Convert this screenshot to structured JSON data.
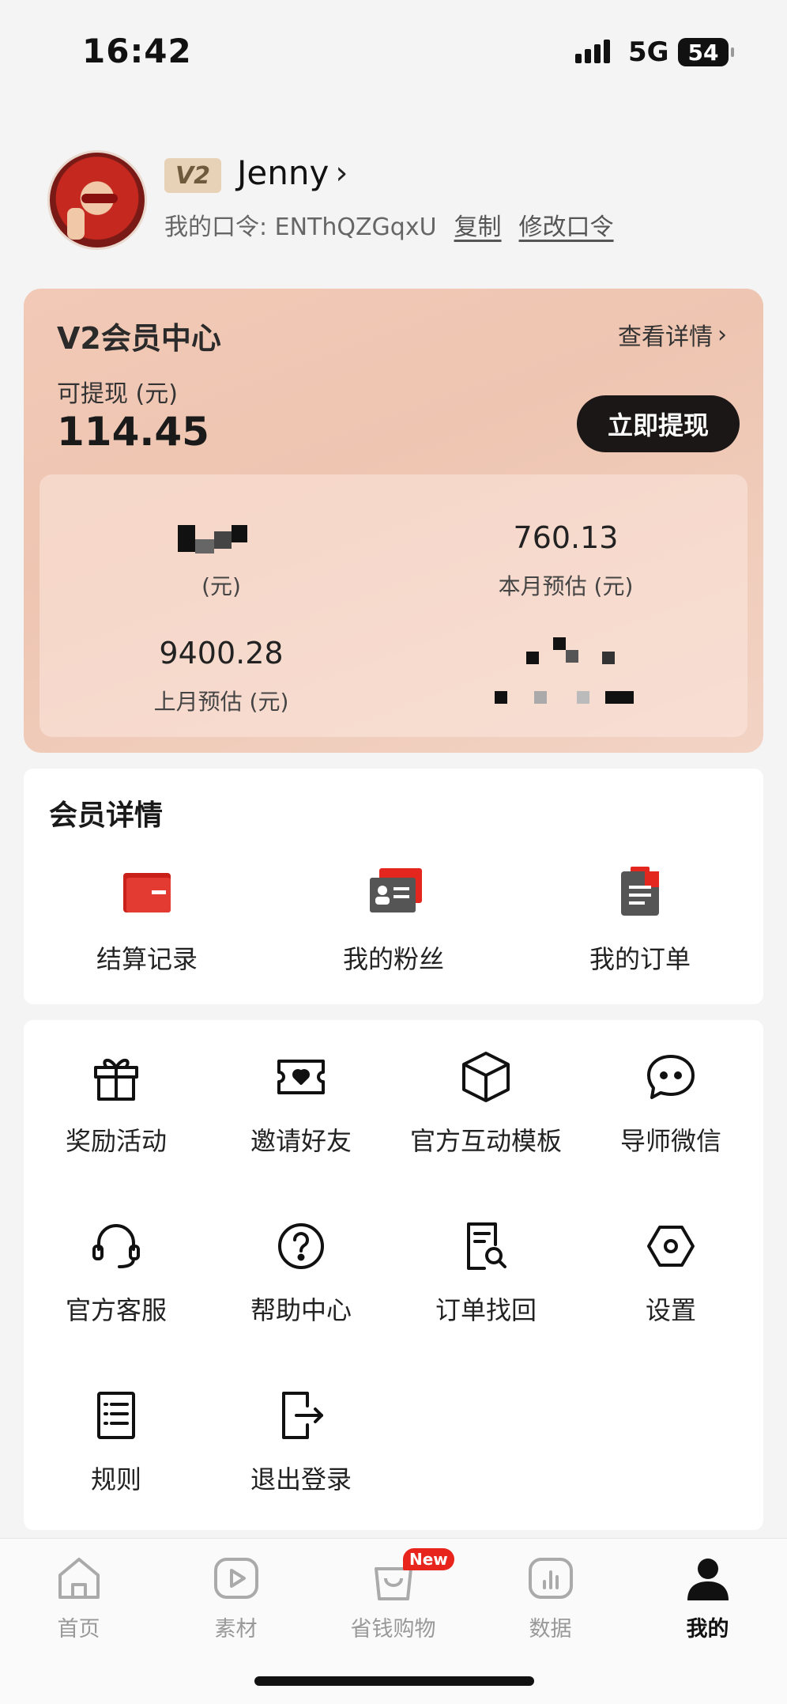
{
  "status": {
    "time": "16:42",
    "network": "5G",
    "battery": "54"
  },
  "profile": {
    "vip": "V2",
    "name": "Jenny",
    "passcode_label": "我的口令: ENThQZGqxU",
    "copy": "复制",
    "change": "修改口令"
  },
  "member_center": {
    "title": "V2会员中心",
    "detail_link": "查看详情",
    "withdrawable_label": "可提现 (元)",
    "withdrawable_amount": "114.45",
    "withdraw_button": "立即提现",
    "stats": [
      {
        "value": "",
        "label": "(元)"
      },
      {
        "value": "760.13",
        "label": "本月预估 (元)"
      },
      {
        "value": "9400.28",
        "label": "上月预估 (元)"
      },
      {
        "value": "",
        "label": ""
      }
    ]
  },
  "member_details": {
    "title": "会员详情",
    "items": [
      {
        "label": "结算记录",
        "icon": "wallet-icon"
      },
      {
        "label": "我的粉丝",
        "icon": "id-card-icon"
      },
      {
        "label": "我的订单",
        "icon": "clipboard-icon"
      }
    ]
  },
  "tools": [
    {
      "label": "奖励活动",
      "icon": "gift-icon"
    },
    {
      "label": "邀请好友",
      "icon": "ticket-heart-icon"
    },
    {
      "label": "官方互动模板",
      "icon": "cube-icon"
    },
    {
      "label": "导师微信",
      "icon": "chat-bubble-icon"
    },
    {
      "label": "官方客服",
      "icon": "headset-icon"
    },
    {
      "label": "帮助中心",
      "icon": "question-icon"
    },
    {
      "label": "订单找回",
      "icon": "doc-search-icon"
    },
    {
      "label": "设置",
      "icon": "hexagon-settings-icon"
    },
    {
      "label": "规则",
      "icon": "list-doc-icon"
    },
    {
      "label": "退出登录",
      "icon": "logout-icon"
    }
  ],
  "tabs": [
    {
      "label": "首页",
      "icon": "home-icon"
    },
    {
      "label": "素材",
      "icon": "play-icon"
    },
    {
      "label": "省钱购物",
      "icon": "shopping-bag-icon",
      "badge": "New"
    },
    {
      "label": "数据",
      "icon": "bar-chart-icon"
    },
    {
      "label": "我的",
      "icon": "person-icon",
      "active": true
    }
  ],
  "colors": {
    "accent": "#e8251c",
    "card": "#f1c9b6",
    "dark_button": "#1b1716"
  }
}
